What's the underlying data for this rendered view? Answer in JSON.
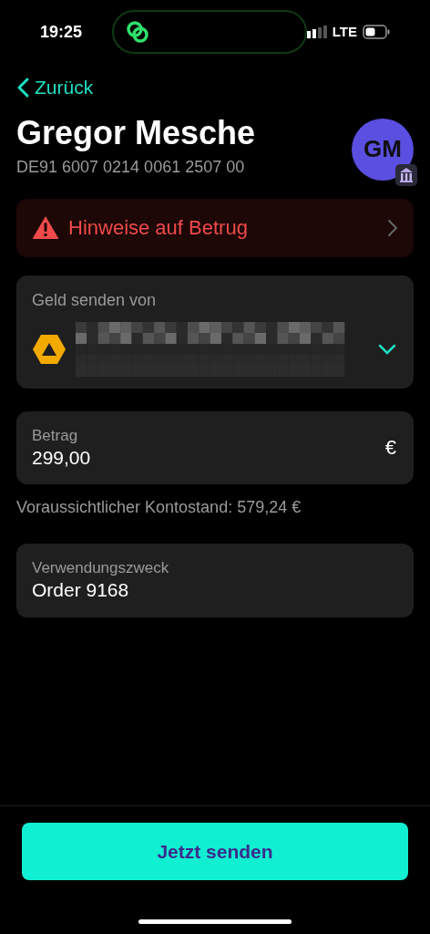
{
  "status_bar": {
    "time": "19:25",
    "network": "LTE"
  },
  "back_link": {
    "label": "Zurück"
  },
  "recipient": {
    "name": "Gregor Mesche",
    "iban": "DE91 6007 0214 0061 2507 00",
    "initials": "GM"
  },
  "fraud_notice": {
    "label": "Hinweise auf Betrug"
  },
  "sender": {
    "label": "Geld senden von"
  },
  "amount": {
    "label": "Betrag",
    "value": "299,00",
    "currency": "€"
  },
  "balance_note": "Voraussichtlicher Kontostand: 579,24 €",
  "purpose": {
    "label": "Verwendungszweck",
    "value": "Order 9168"
  },
  "send_button": {
    "label": "Jetzt senden"
  }
}
